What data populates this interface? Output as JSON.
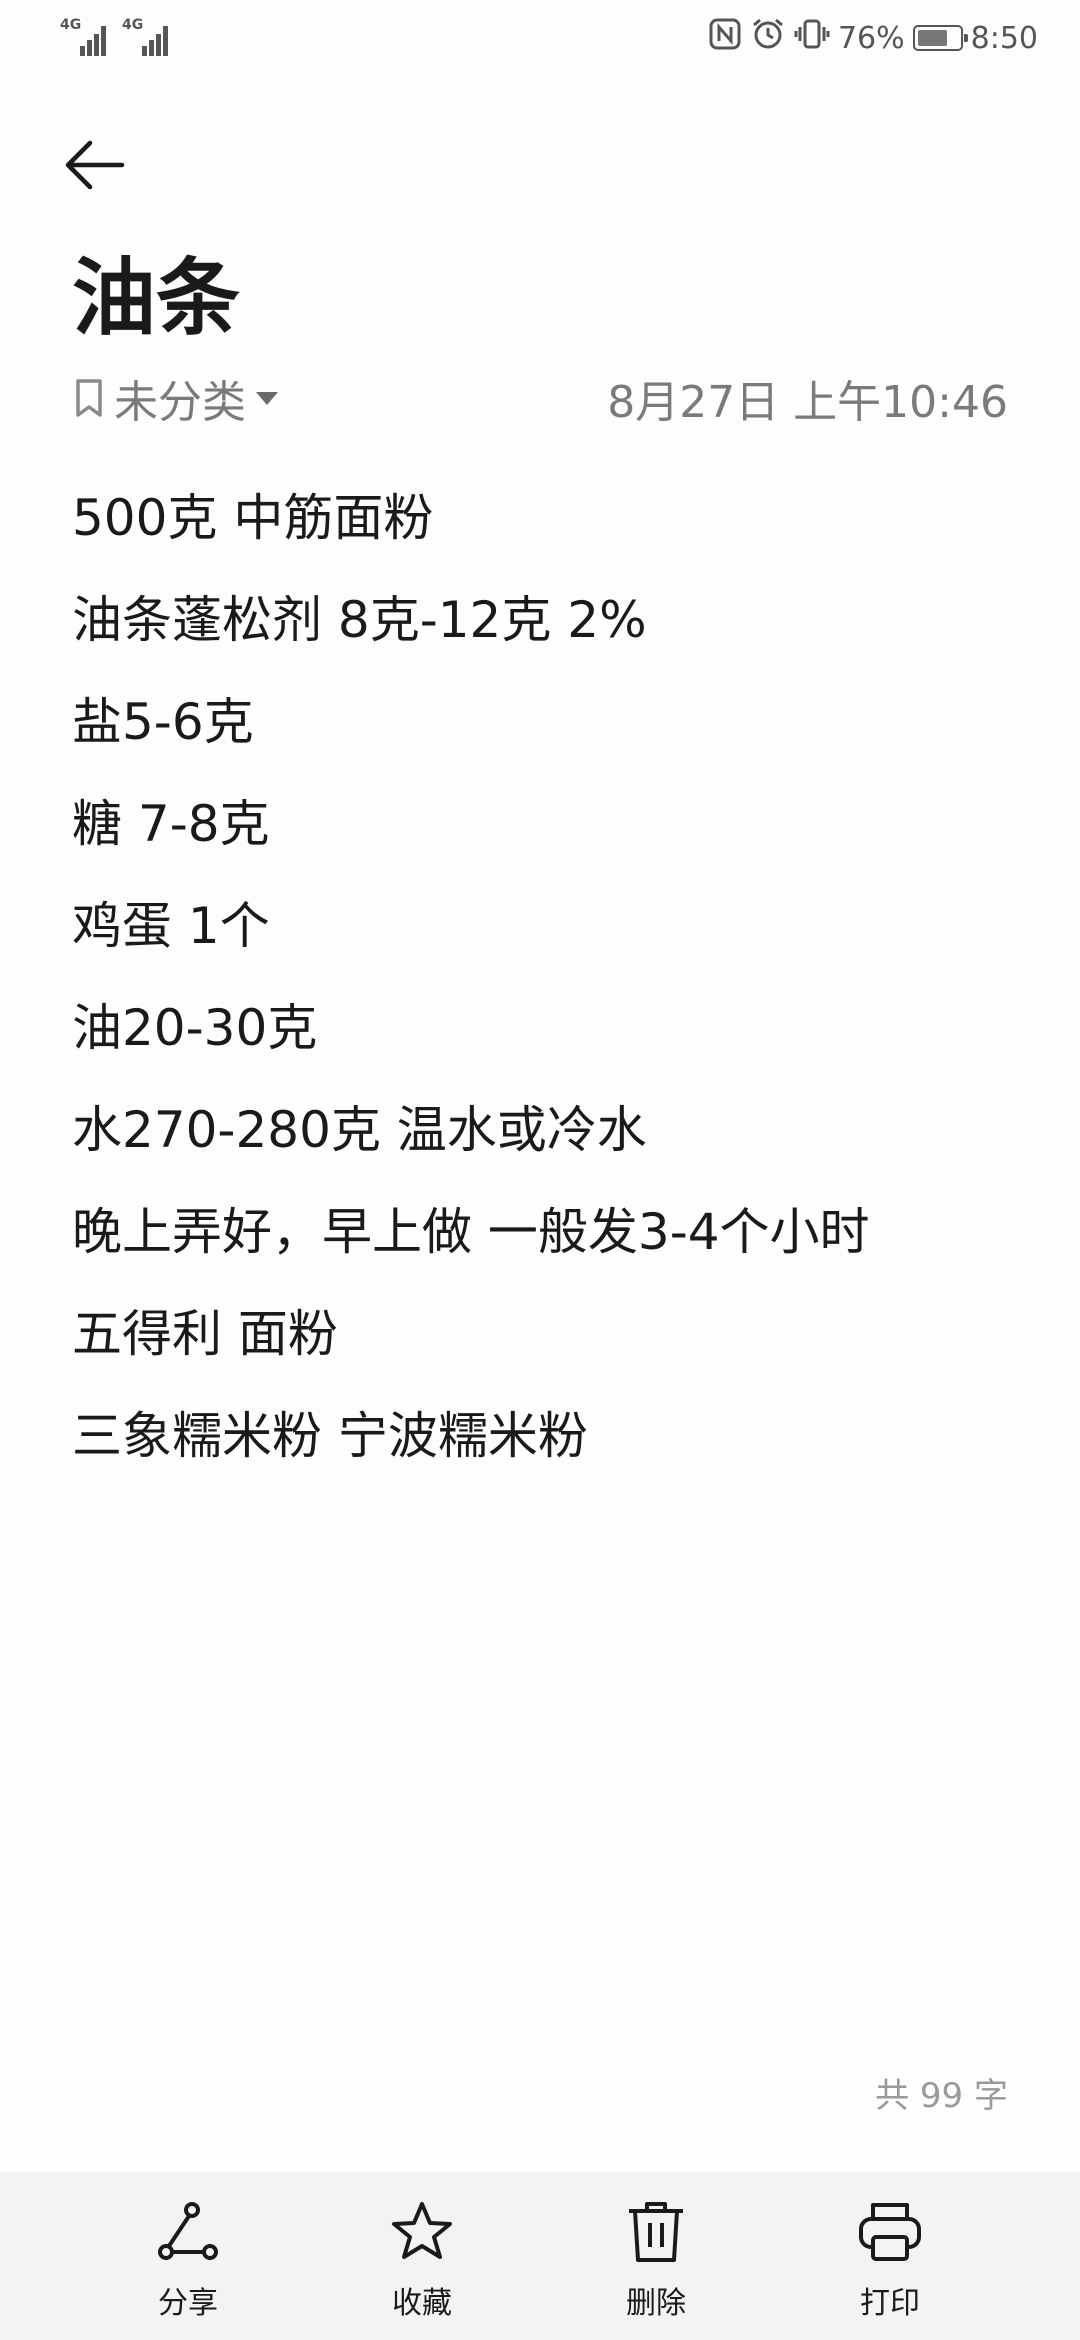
{
  "status_bar": {
    "network_1": "4G",
    "network_2": "4G",
    "battery_percent": "76%",
    "battery_level": 0.76,
    "time": "8:50",
    "icons": [
      "nfc-icon",
      "alarm-icon",
      "vibrate-icon"
    ]
  },
  "note": {
    "title": "油条",
    "category": "未分类",
    "date": "8月27日 上午10:46",
    "lines": [
      "500克 中筋面粉",
      "油条蓬松剂 8克-12克 2%",
      "盐5-6克",
      "糖 7-8克",
      "鸡蛋 1个",
      "油20-30克",
      "水270-280克 温水或冷水",
      "晚上弄好，早上做 一般发3-4个小时",
      "五得利 面粉",
      "三象糯米粉 宁波糯米粉"
    ],
    "word_count": "共 99 字"
  },
  "toolbar": {
    "share": "分享",
    "favorite": "收藏",
    "delete": "删除",
    "print": "打印"
  }
}
